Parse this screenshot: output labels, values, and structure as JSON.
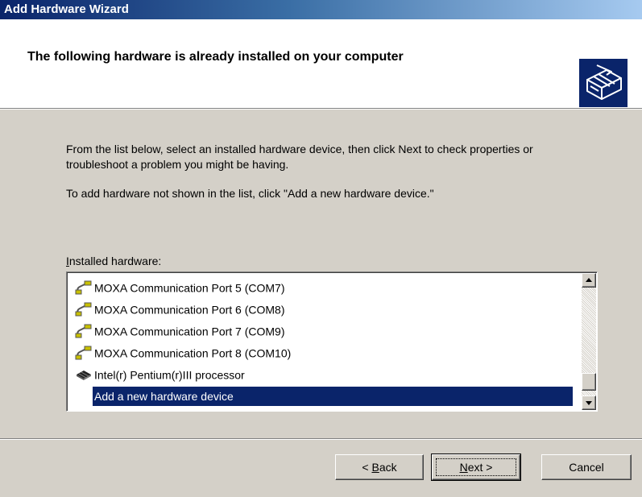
{
  "window": {
    "title": "Add Hardware Wizard"
  },
  "header": {
    "title": "The following hardware is already installed on your computer",
    "icon": "hardware-wizard-icon"
  },
  "body": {
    "paragraph1": "From the list below, select an installed hardware device, then click Next to check properties or troubleshoot a problem you might be having.",
    "paragraph2": "To add hardware not shown in the list, click \"Add a new hardware device.\""
  },
  "installed_hardware": {
    "label_accel": "I",
    "label_rest": "nstalled hardware:",
    "items": [
      {
        "label": "MOXA Communication Port 5 (COM7)",
        "icon": "port-icon"
      },
      {
        "label": "MOXA Communication Port 6 (COM8)",
        "icon": "port-icon"
      },
      {
        "label": "MOXA Communication Port 7 (COM9)",
        "icon": "port-icon"
      },
      {
        "label": "MOXA Communication Port 8 (COM10)",
        "icon": "port-icon"
      },
      {
        "label": "Intel(r) Pentium(r)III processor",
        "icon": "processor-icon"
      },
      {
        "label": "Add a new hardware device",
        "icon": "none",
        "selected": true
      }
    ]
  },
  "buttons": {
    "back": {
      "prefix": "< ",
      "accel": "B",
      "rest": "ack"
    },
    "next": {
      "accel": "N",
      "rest": "ext >"
    },
    "cancel": "Cancel"
  },
  "colors": {
    "title_gradient_start": "#0a246a",
    "title_gradient_end": "#a6caf0",
    "selection": "#0a246a",
    "face": "#d4d0c8"
  }
}
